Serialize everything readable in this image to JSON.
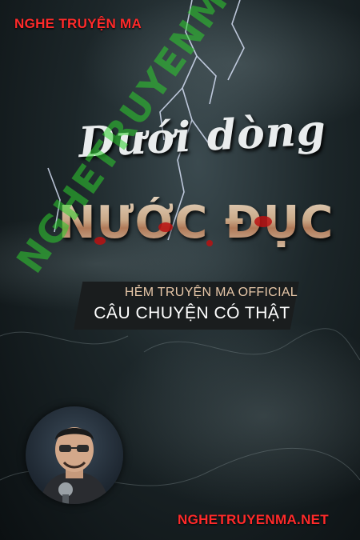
{
  "cover": {
    "top_label": "NGHE TRUYỆN MA",
    "title_line1": "Dưới dòng",
    "title_line2": "NƯỚC ĐỤC",
    "banner_line1": "HẺM TRUYỆN MA OFFICIAL",
    "banner_line2": "CÂU CHUYỆN CÓ THẬT",
    "watermark": "NGHETRUYENMA.NET",
    "bottom_label": "NGHETRUYENMA.NET"
  },
  "icons": {
    "lightning": "lightning-icon",
    "avatar": "narrator-avatar"
  },
  "colors": {
    "label_red": "#ff2a2a",
    "watermark_green": "#2ecf2e",
    "blood_red": "#b81212"
  }
}
